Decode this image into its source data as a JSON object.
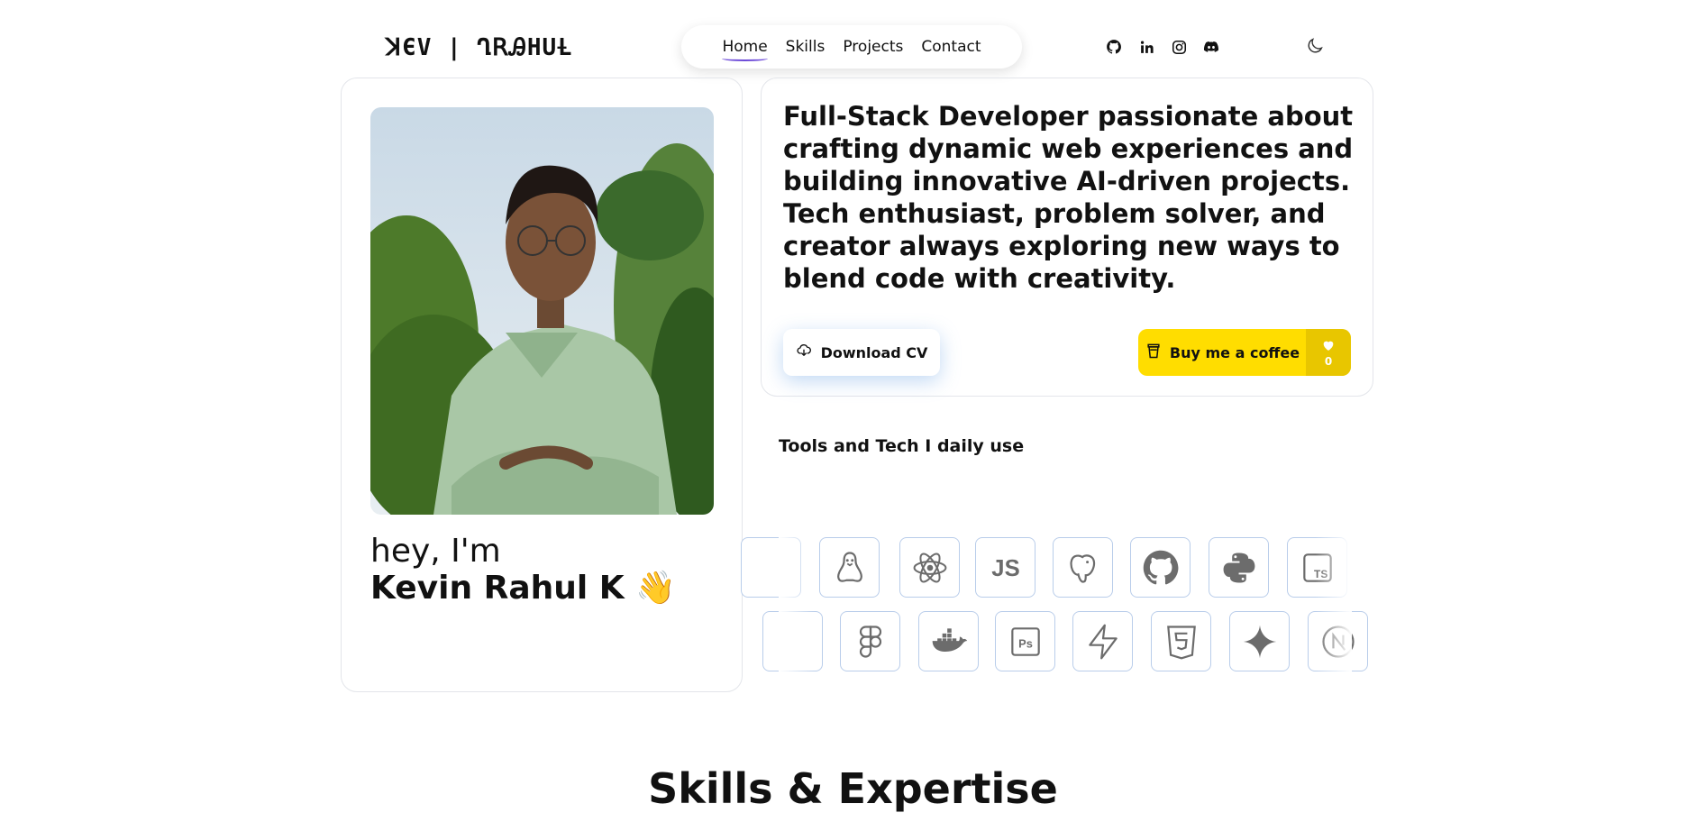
{
  "header": {
    "logo": "ꓘЄV | ՂꓣᎯHUȽ",
    "nav": [
      {
        "label": "Home",
        "active": true
      },
      {
        "label": "Skills"
      },
      {
        "label": "Projects"
      },
      {
        "label": "Contact"
      }
    ],
    "socials": [
      "github-icon",
      "linkedin-icon",
      "instagram-icon",
      "discord-icon"
    ],
    "theme_icon": "moon-icon"
  },
  "profile": {
    "greeting": "hey, I'm",
    "name": "Kevin Rahul K 👋"
  },
  "intro": {
    "bio": "Full-Stack Developer passionate about crafting dynamic web experiences and building innovative AI-driven projects. Tech enthusiast, problem solver, and creator always exploring new ways to blend code with creativity.",
    "download_cv": "Download CV",
    "coffee_label": "Buy me a coffee",
    "coffee_count": "0"
  },
  "tools": {
    "title": "Tools and Tech I daily use",
    "row1": [
      "partial-icon",
      "linux-icon",
      "react-icon",
      "javascript-icon",
      "postgresql-icon",
      "github-icon",
      "python-icon",
      "typescript-icon"
    ],
    "row2": [
      "partial-icon",
      "figma-icon",
      "docker-icon",
      "photoshop-icon",
      "supabase-icon",
      "html5-icon",
      "gemini-icon",
      "nextjs-icon"
    ]
  },
  "sections": {
    "skills_title": "Skills & Expertise"
  },
  "colors": {
    "coffee_yellow": "#ffdd00",
    "coffee_side": "#e8c600",
    "tile_border": "#b9cdea",
    "nav_underline": "#6d4bd8"
  }
}
